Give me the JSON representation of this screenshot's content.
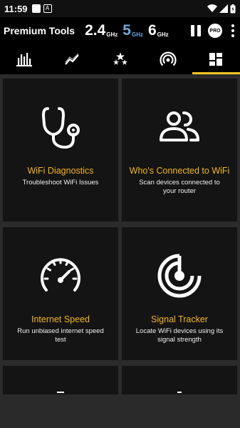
{
  "status_bar": {
    "time": "11:59",
    "a_icon_letter": "A",
    "icons": [
      "notification-square-icon",
      "a-notification-icon",
      "wifi-icon",
      "signal-icon",
      "battery-icon"
    ]
  },
  "app_bar": {
    "title": "Premium Tools",
    "frequencies": [
      {
        "value": "2.4",
        "unit": "GHz",
        "color": "#ffffff"
      },
      {
        "value": "5",
        "unit": "GHz",
        "color": "#6fa8dc"
      },
      {
        "value": "6",
        "unit": "GHz",
        "color": "#ffffff"
      }
    ],
    "pro_label": "PRO"
  },
  "tabs": [
    {
      "icon": "bar-chart-icon",
      "active": false
    },
    {
      "icon": "line-chart-icon",
      "active": false
    },
    {
      "icon": "stars-icon",
      "active": false
    },
    {
      "icon": "signal-radar-icon",
      "active": false
    },
    {
      "icon": "dashboard-icon",
      "active": true
    }
  ],
  "accent_color": "#f3c623",
  "cards": [
    {
      "title": "WiFi Diagnostics",
      "subtitle": "Troubleshoot WiFi Issues",
      "icon": "stethoscope-icon"
    },
    {
      "title": "Who's Connected to WiFi",
      "subtitle": "Scan devices connected to your router",
      "icon": "people-icon"
    },
    {
      "title": "Internet Speed",
      "subtitle": "Run unbiased internet speed test",
      "icon": "speedometer-icon"
    },
    {
      "title": "Signal Tracker",
      "subtitle": "Locate WiFi devices using its signal strength",
      "icon": "signal-tracker-icon"
    }
  ]
}
